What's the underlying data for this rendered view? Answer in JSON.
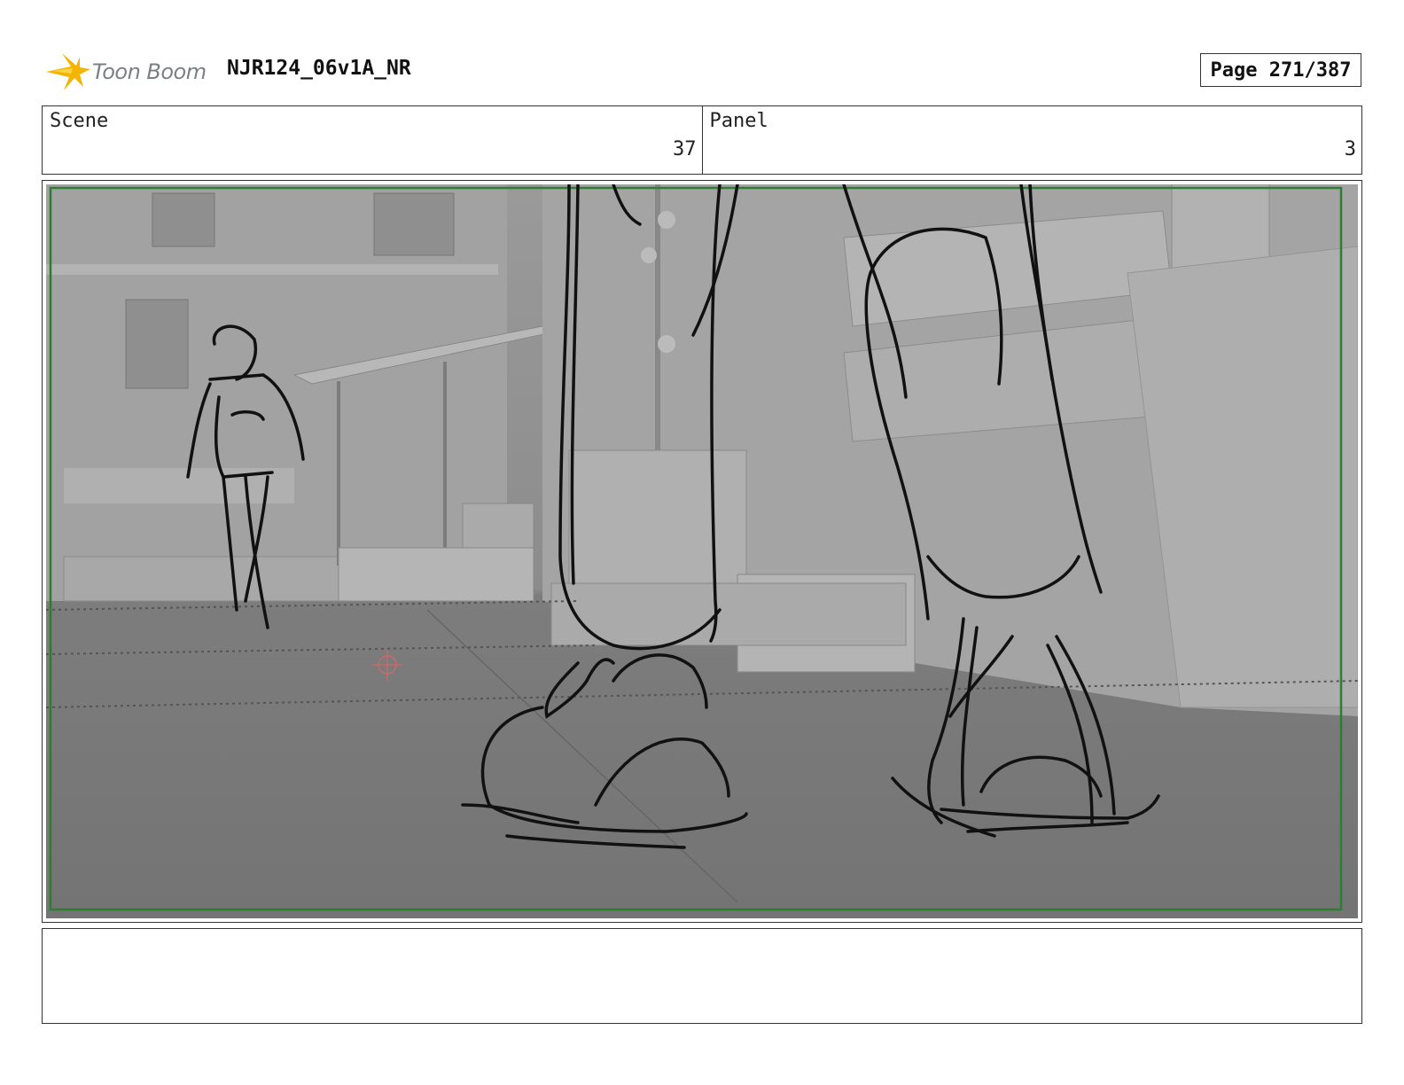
{
  "header": {
    "logo_text": "Toon Boom",
    "document_title": "NJR124_06v1A_NR",
    "page_label": "Page 271/387"
  },
  "panel_info": {
    "scene_label": "Scene",
    "scene_value": "37",
    "panel_label": "Panel",
    "panel_value": "3"
  },
  "notes": {
    "text": ""
  },
  "colors": {
    "safe_frame": "#2e7d32",
    "logo_accent": "#f5b400"
  }
}
